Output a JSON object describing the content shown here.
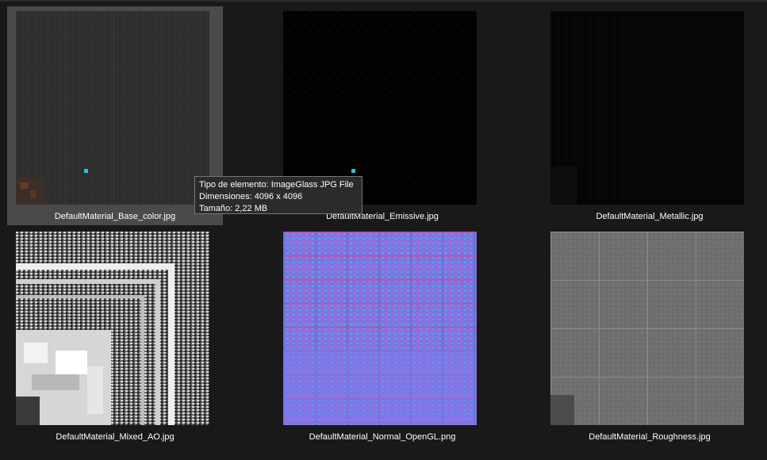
{
  "files": [
    {
      "name": "DefaultMaterial_Base_color.jpg",
      "icon": "base-color-thumbnail",
      "selected": true
    },
    {
      "name": "DefaultMaterial_Emissive.jpg",
      "icon": "emissive-thumbnail",
      "selected": false
    },
    {
      "name": "DefaultMaterial_Metallic.jpg",
      "icon": "metallic-thumbnail",
      "selected": false
    },
    {
      "name": "DefaultMaterial_Mixed_AO.jpg",
      "icon": "mixed-ao-thumbnail",
      "selected": false
    },
    {
      "name": "DefaultMaterial_Normal_OpenGL.png",
      "icon": "normal-map-thumbnail",
      "selected": false
    },
    {
      "name": "DefaultMaterial_Roughness.jpg",
      "icon": "roughness-thumbnail",
      "selected": false
    }
  ],
  "tooltip": {
    "type_line": "Tipo de elemento: ImageGlass JPG File",
    "dimensions_line": "Dimensiones: 4096 x 4096",
    "size_line": "Tamaño: 2,22 MB"
  },
  "colors": {
    "background": "#191919",
    "selection": "#4a4a4a",
    "tooltip_bg": "#2b2b2b",
    "tooltip_border": "#767676",
    "cyan_marker": "#22c7e6"
  }
}
